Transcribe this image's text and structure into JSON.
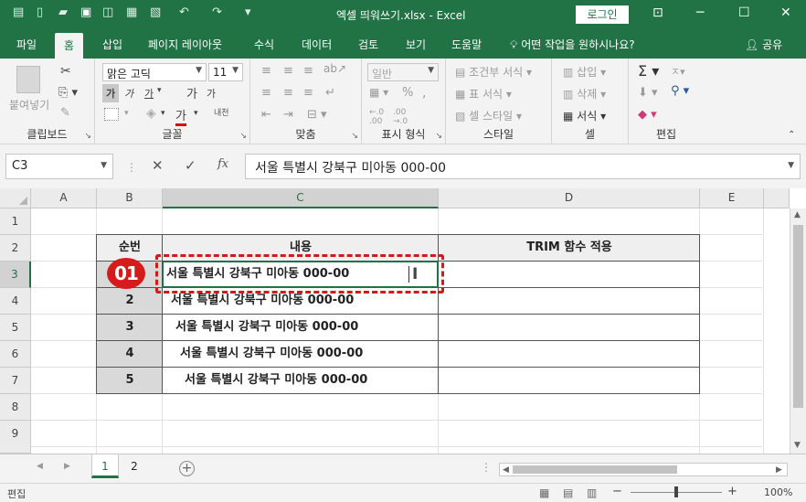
{
  "window": {
    "title": "엑셀 띄워쓰기.xlsx  -  Excel",
    "login_label": "로그인",
    "quick_access": [
      "autosave-icon",
      "new-icon",
      "open-icon",
      "save-icon",
      "preview-icon",
      "undo-icon",
      "redo-icon",
      "customize-icon"
    ]
  },
  "ribbon": {
    "tabs": [
      "파일",
      "홈",
      "삽입",
      "페이지 레이아웃",
      "수식",
      "데이터",
      "검토",
      "보기",
      "도움말"
    ],
    "active_tab": "홈",
    "tell_me": "어떤 작업을 원하시나요?",
    "share": "공유",
    "clipboard": {
      "paste": "붙여넣기",
      "label": "클립보드"
    },
    "font": {
      "name": "맑은 고딕",
      "size": "11",
      "bold": "가",
      "italic": "가",
      "underline": "가",
      "grow": "가",
      "shrink": "가",
      "color": "가",
      "phonetic": "내천",
      "label": "글꼴"
    },
    "alignment": {
      "label": "맞춤"
    },
    "number": {
      "format": "일반",
      "label": "표시 형식"
    },
    "styles": {
      "conditional": "조건부 서식",
      "table": "표 서식",
      "cell": "셀 스타일",
      "label": "스타일"
    },
    "cells": {
      "insert": "삽입",
      "delete": "삭제",
      "format": "서식",
      "label": "셀"
    },
    "editing": {
      "label": "편집"
    }
  },
  "formula_bar": {
    "name_box": "C3",
    "content": "서울 특별시 강북구 미아동 000-00"
  },
  "sheet": {
    "columns": [
      "A",
      "B",
      "C",
      "D",
      "E"
    ],
    "rows": [
      "1",
      "2",
      "3",
      "4",
      "5",
      "6",
      "7",
      "8",
      "9"
    ],
    "headers": {
      "b": "순번",
      "c": "내용",
      "d": "TRIM 함수 적용"
    },
    "data": [
      {
        "num": "1",
        "text": "서울 특별시 강북구 미아동 000-00"
      },
      {
        "num": "2",
        "text": "서울 특별시 강북구 미아동 000-00"
      },
      {
        "num": "3",
        "text": "서울 특별시 강북구 미아동 000-00"
      },
      {
        "num": "4",
        "text": "서울 특별시 강북구 미아동 000-00"
      },
      {
        "num": "5",
        "text": "서울 특별시 강북구 미아동 000-00"
      }
    ],
    "badge": "01"
  },
  "sheet_tabs": [
    "1",
    "2"
  ],
  "status": {
    "mode": "편집",
    "zoom": "100%"
  },
  "colors": {
    "excel_green": "#217346",
    "badge_red": "#d61b1b"
  }
}
